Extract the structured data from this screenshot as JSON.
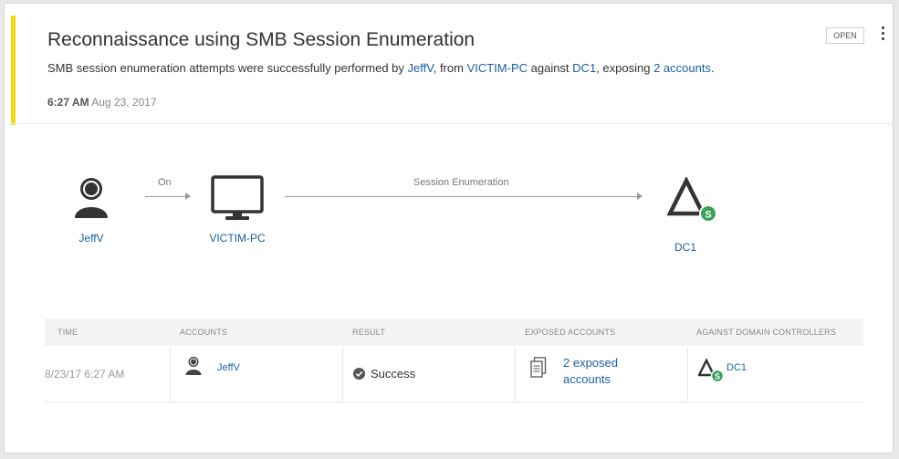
{
  "alert": {
    "title": "Reconnaissance using SMB Session Enumeration",
    "description": {
      "prefix": "SMB session enumeration attempts were successfully performed by ",
      "user": "JeffV",
      "mid1": ", from ",
      "source": "VICTIM-PC",
      "mid2": " against ",
      "target": "DC1",
      "mid3": ", exposing ",
      "accounts": "2 accounts",
      "suffix": "."
    },
    "time": "6:27 AM",
    "date": "Aug 23, 2017",
    "status_button": "OPEN",
    "accent_color": "#f5d90a"
  },
  "flow": {
    "user_label": "JeffV",
    "edge1_label": "On",
    "computer_label": "VICTIM-PC",
    "edge2_label": "Session Enumeration",
    "dc_label": "DC1"
  },
  "table": {
    "headers": [
      "TIME",
      "ACCOUNTS",
      "RESULT",
      "EXPOSED ACCOUNTS",
      "AGAINST DOMAIN CONTROLLERS"
    ],
    "row": {
      "time": "8/23/17 6:27 AM",
      "account": "JeffV",
      "result": "Success",
      "exposed_line1": "2 exposed",
      "exposed_line2": "accounts",
      "dc": "DC1"
    }
  }
}
